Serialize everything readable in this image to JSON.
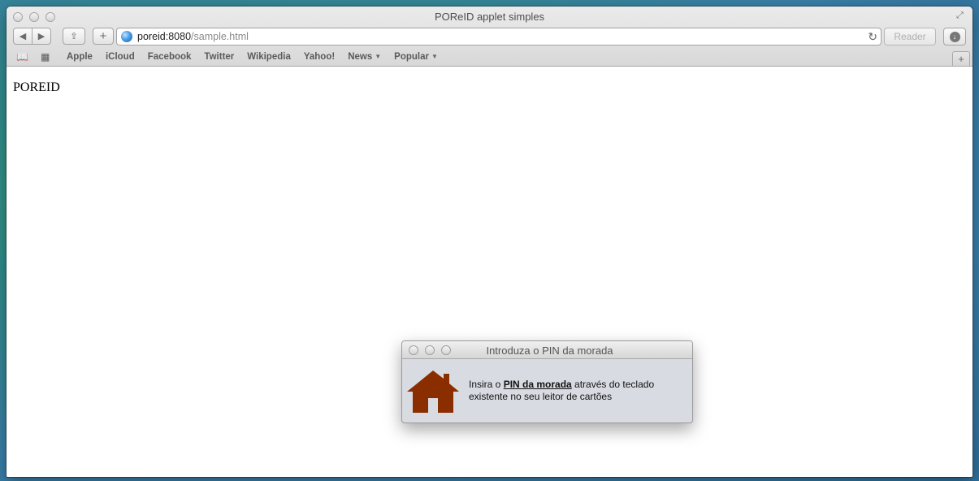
{
  "browser": {
    "window_title": "POReID applet simples",
    "url_host": "poreid:8080",
    "url_path": "/sample.html",
    "reader_label": "Reader",
    "bookmarks": [
      {
        "label": "Apple",
        "menu": false
      },
      {
        "label": "iCloud",
        "menu": false
      },
      {
        "label": "Facebook",
        "menu": false
      },
      {
        "label": "Twitter",
        "menu": false
      },
      {
        "label": "Wikipedia",
        "menu": false
      },
      {
        "label": "Yahoo!",
        "menu": false
      },
      {
        "label": "News",
        "menu": true
      },
      {
        "label": "Popular",
        "menu": true
      }
    ]
  },
  "page": {
    "heading": "POREID"
  },
  "dialog": {
    "title": "Introduza o PIN da morada",
    "text_before": "Insira o ",
    "text_bold": "PIN da morada",
    "text_after": " através do teclado existente no seu leitor de cartões",
    "icon_color": "#8a2e00"
  }
}
